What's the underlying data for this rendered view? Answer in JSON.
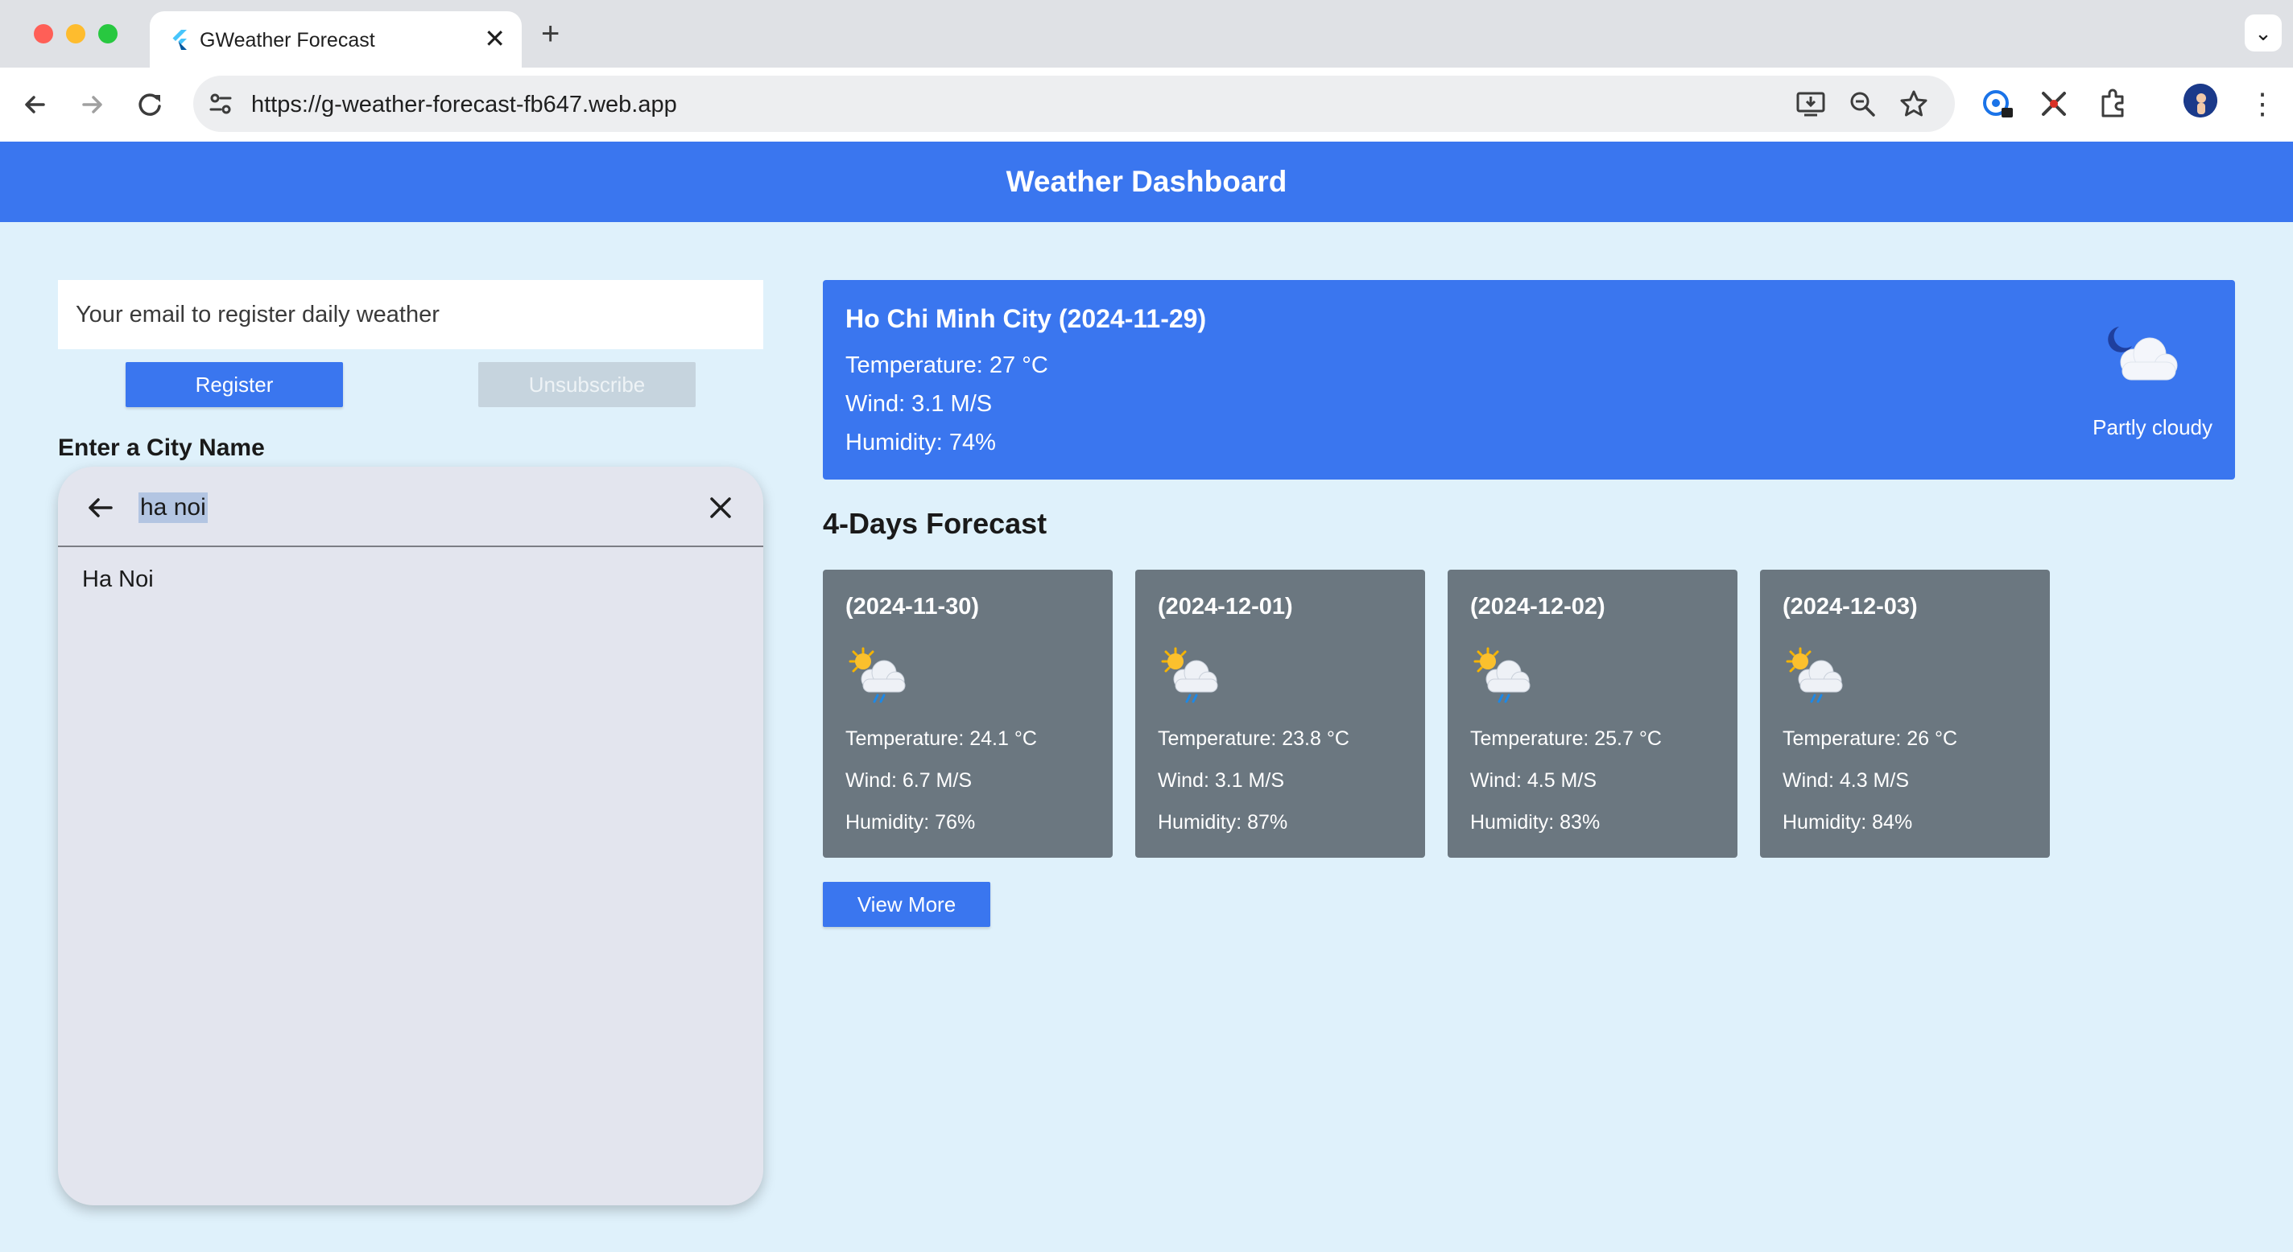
{
  "browser": {
    "tab_title": "GWeather Forecast",
    "url": "https://g-weather-forecast-fb647.web.app"
  },
  "app": {
    "title": "Weather Dashboard",
    "email_placeholder": "Your email to register daily weather",
    "register_label": "Register",
    "unsubscribe_label": "Unsubscribe",
    "city_label": "Enter a City Name",
    "search": {
      "query": "ha noi",
      "suggestions": [
        "Ha Noi"
      ]
    }
  },
  "current": {
    "heading": "Ho Chi Minh City (2024-11-29)",
    "temperature": "Temperature: 27 °C",
    "wind": "Wind: 3.1 M/S",
    "humidity": "Humidity: 74%",
    "condition": "Partly cloudy",
    "icon": "moon-cloud-icon"
  },
  "forecast": {
    "title": "4-Days Forecast",
    "days": [
      {
        "date": "(2024-11-30)",
        "temperature": "Temperature: 24.1 °C",
        "wind": "Wind: 6.7 M/S",
        "humidity": "Humidity: 76%",
        "icon": "sun-rain-cloud-icon"
      },
      {
        "date": "(2024-12-01)",
        "temperature": "Temperature: 23.8 °C",
        "wind": "Wind: 3.1 M/S",
        "humidity": "Humidity: 87%",
        "icon": "sun-rain-cloud-icon"
      },
      {
        "date": "(2024-12-02)",
        "temperature": "Temperature: 25.7 °C",
        "wind": "Wind: 4.5 M/S",
        "humidity": "Humidity: 83%",
        "icon": "sun-rain-cloud-icon"
      },
      {
        "date": "(2024-12-03)",
        "temperature": "Temperature: 26 °C",
        "wind": "Wind: 4.3 M/S",
        "humidity": "Humidity: 84%",
        "icon": "sun-rain-cloud-icon"
      }
    ],
    "view_more_label": "View More"
  },
  "colors": {
    "primary": "#3a76ef",
    "page_bg": "#dff1fb",
    "card_bg": "#6b7780",
    "search_panel_bg": "#e3e5ee"
  }
}
